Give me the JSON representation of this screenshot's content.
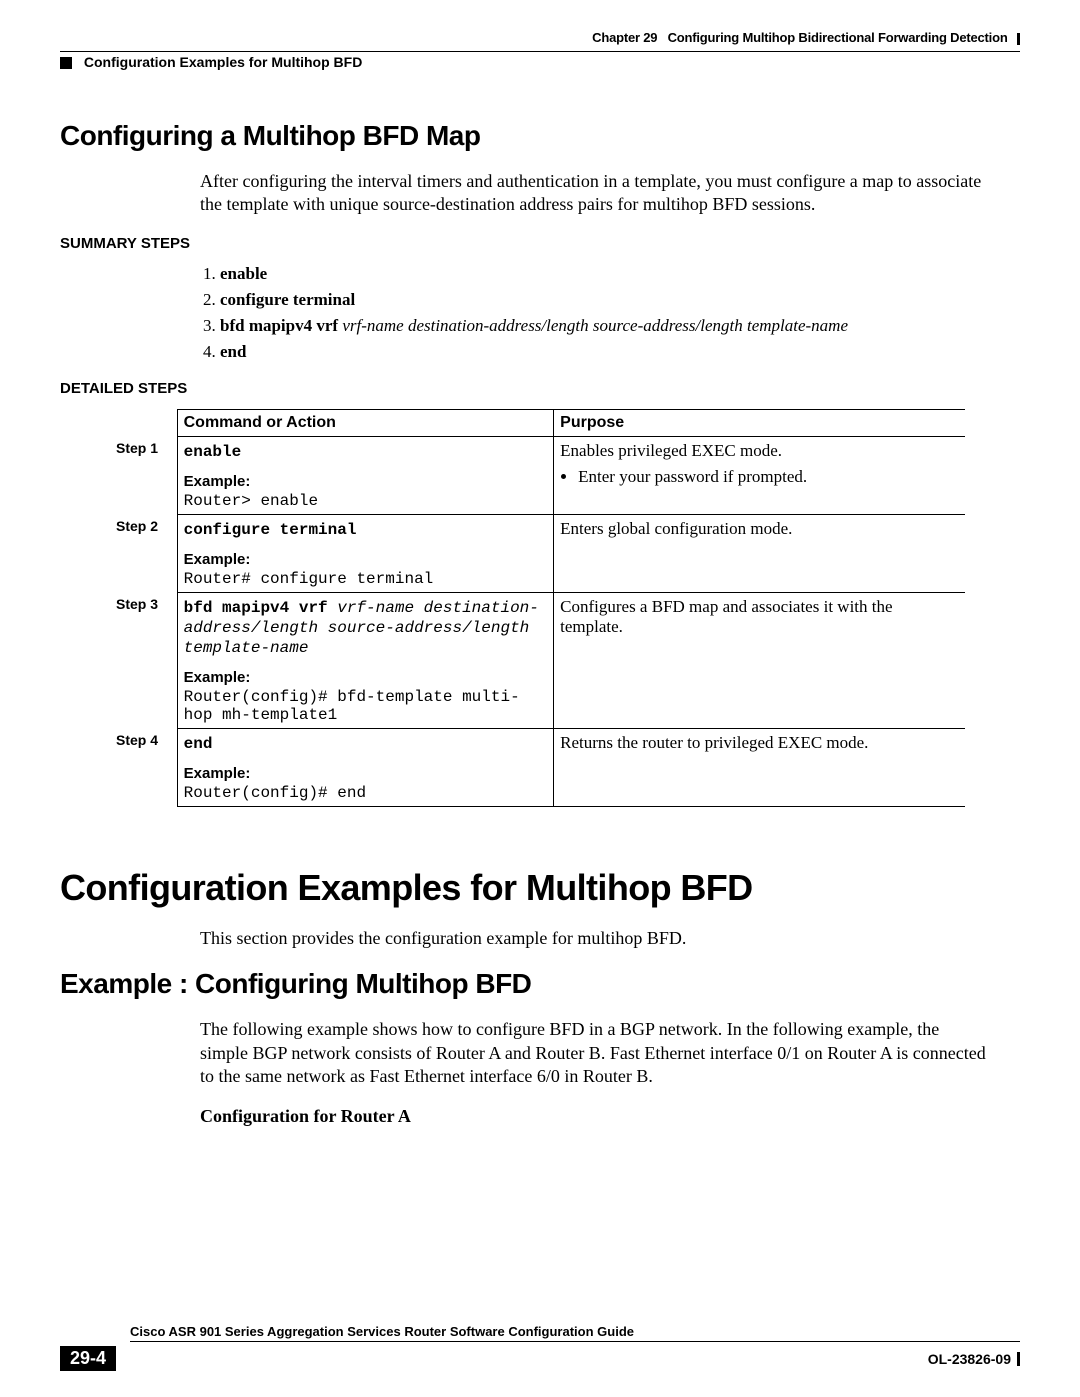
{
  "header": {
    "chapter_label": "Chapter 29",
    "chapter_title": "Configuring Multihop Bidirectional Forwarding Detection",
    "section_title": "Configuration Examples for Multihop BFD"
  },
  "section1": {
    "heading": "Configuring a Multihop BFD Map",
    "intro": "After configuring the interval timers and authentication in a template, you must configure a map to associate the template with unique source-destination address pairs for multihop BFD sessions.",
    "summary_label": "SUMMARY STEPS",
    "summary_steps": [
      {
        "cmd": "enable"
      },
      {
        "cmd": "configure terminal"
      },
      {
        "cmd": "bfd mapipv4 vrf ",
        "var": "vrf-name destination-address/length source-address/length template-name"
      },
      {
        "cmd": "end"
      }
    ],
    "detailed_label": "DETAILED STEPS",
    "table": {
      "head_command": "Command or Action",
      "head_purpose": "Purpose",
      "rows": [
        {
          "step": "Step 1",
          "command_bold": "enable",
          "command_italic": "",
          "example_label": "Example:",
          "example": "Router> enable",
          "purpose_main": "Enables privileged EXEC mode.",
          "purpose_bullet": "Enter your password if prompted."
        },
        {
          "step": "Step 2",
          "command_bold": "configure terminal",
          "command_italic": "",
          "example_label": "Example:",
          "example": "Router# configure terminal",
          "purpose_main": "Enters global configuration mode.",
          "purpose_bullet": ""
        },
        {
          "step": "Step 3",
          "command_bold": "bfd mapipv4 vrf ",
          "command_italic": "vrf-name destination-address/length source-address/length template-name",
          "example_label": "Example:",
          "example": "Router(config)# bfd-template multi-hop mh-template1",
          "purpose_main": "Configures a BFD map and associates it with the template.",
          "purpose_bullet": ""
        },
        {
          "step": "Step 4",
          "command_bold": "end",
          "command_italic": "",
          "example_label": "Example:",
          "example": "Router(config)# end",
          "purpose_main": "Returns the router to privileged EXEC mode.",
          "purpose_bullet": ""
        }
      ]
    }
  },
  "section2": {
    "heading": "Configuration Examples for Multihop BFD",
    "intro": "This section provides the configuration example for multihop BFD."
  },
  "section3": {
    "heading": "Example : Configuring Multihop BFD",
    "intro": "The following example shows how to configure BFD in a BGP network. In the following example, the simple BGP network consists of Router A and Router B. Fast Ethernet interface 0/1 on Router A is connected to the same network as Fast Ethernet interface 6/0 in Router B.",
    "subhead": "Configuration for Router A"
  },
  "footer": {
    "guide": "Cisco ASR 901 Series Aggregation Services Router Software Configuration Guide",
    "page": "29-4",
    "docnum": "OL-23826-09"
  }
}
